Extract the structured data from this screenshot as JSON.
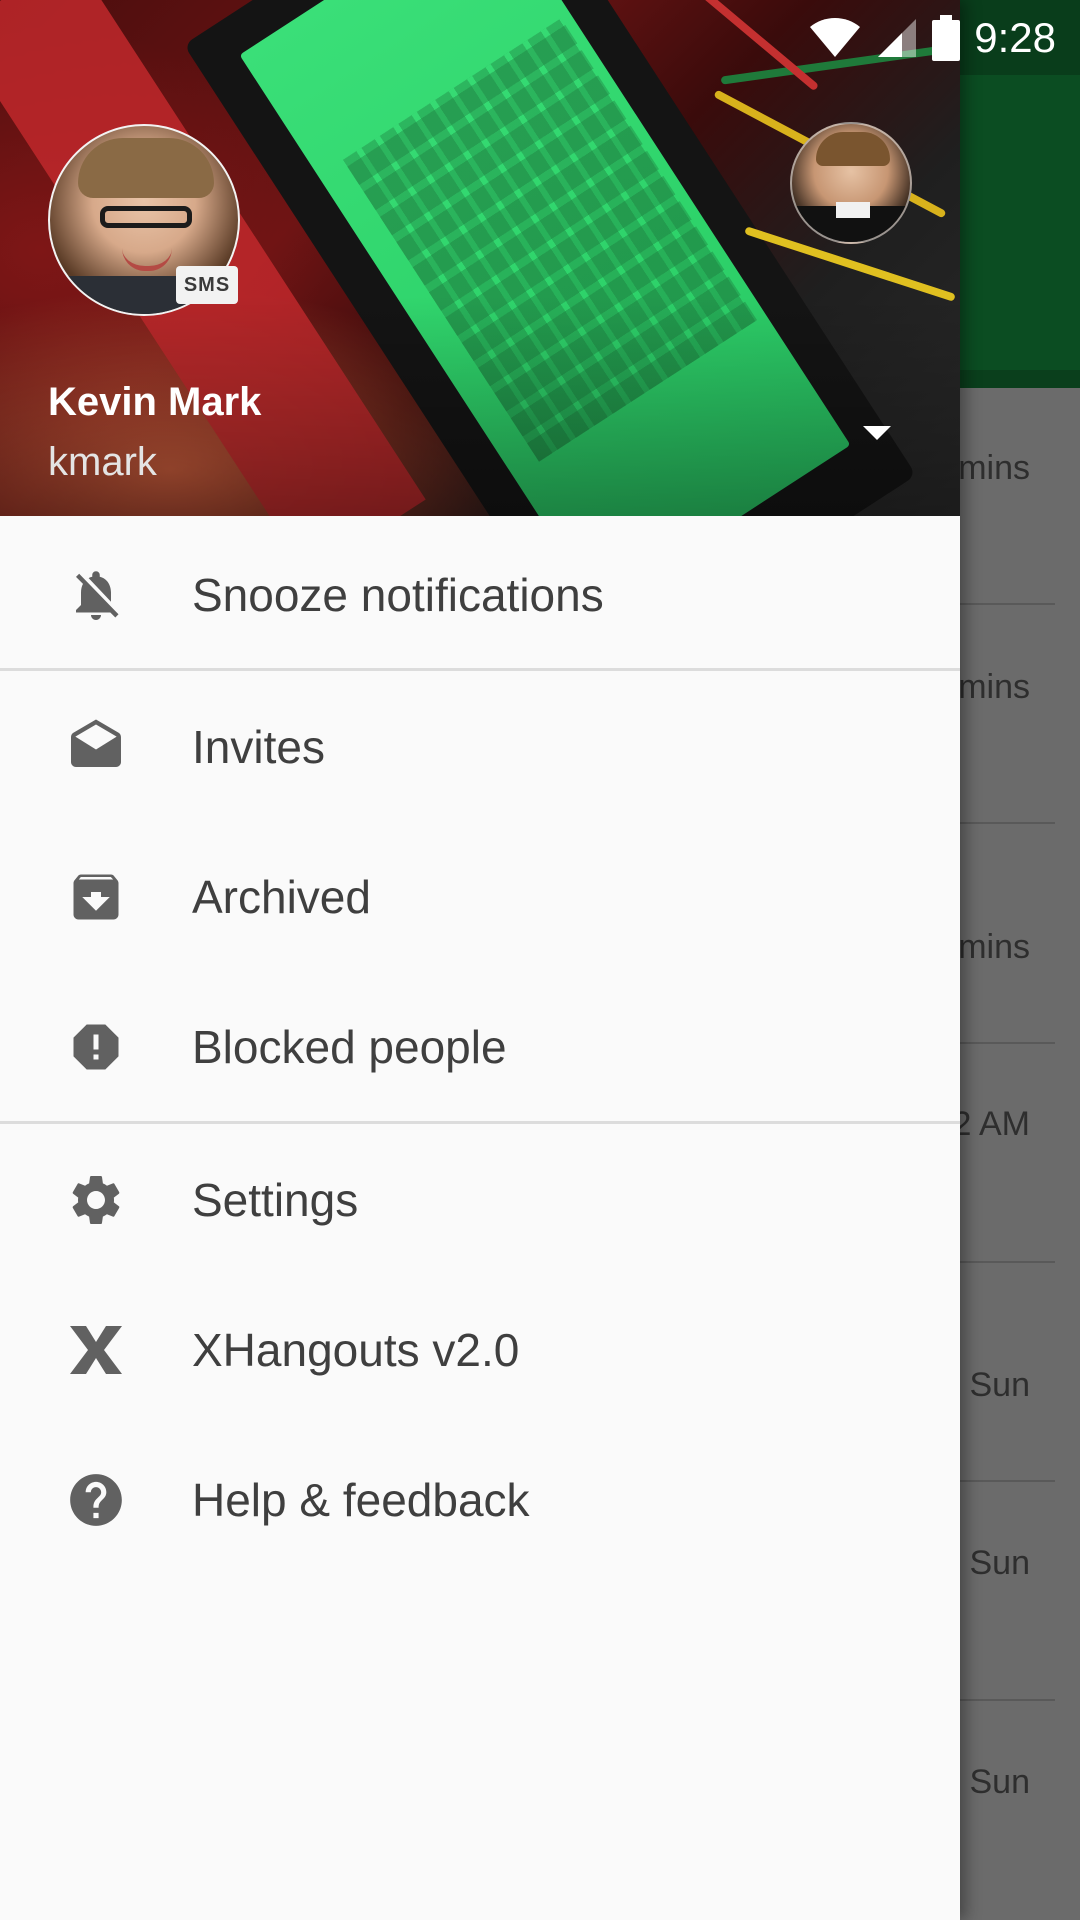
{
  "status_bar": {
    "time": "9:28"
  },
  "drawer": {
    "account": {
      "name": "Kevin Mark",
      "handle": "kmark",
      "badge": "SMS"
    },
    "sections": [
      {
        "items": [
          {
            "label": "Snooze notifications",
            "icon": "snooze-bell-icon"
          }
        ]
      },
      {
        "items": [
          {
            "label": "Invites",
            "icon": "envelope-open-icon"
          },
          {
            "label": "Archived",
            "icon": "archive-icon"
          },
          {
            "label": "Blocked people",
            "icon": "blocked-alert-icon"
          }
        ]
      },
      {
        "items": [
          {
            "label": "Settings",
            "icon": "gear-icon"
          },
          {
            "label": "XHangouts v2.0",
            "icon": "x-icon"
          },
          {
            "label": "Help & feedback",
            "icon": "help-icon"
          }
        ]
      }
    ]
  },
  "background_list": {
    "times": [
      "mins",
      "mins",
      "mins",
      "2 AM",
      "Sun",
      "Sun",
      "Sun"
    ]
  },
  "colors": {
    "drawer_bg": "#fafafa",
    "menu_text": "#3f3f3f",
    "icon": "#616161",
    "app_bar": "#0b4d22"
  }
}
